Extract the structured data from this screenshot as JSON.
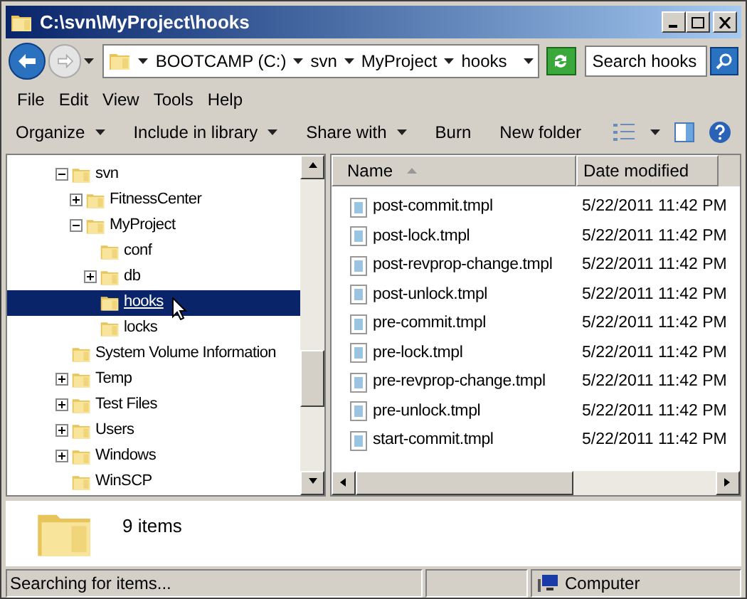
{
  "window": {
    "title": "C:\\svn\\MyProject\\hooks"
  },
  "address": {
    "crumbs": [
      "BOOTCAMP (C:)",
      "svn",
      "MyProject",
      "hooks"
    ]
  },
  "search": {
    "placeholder": "Search hooks"
  },
  "menu": [
    "File",
    "Edit",
    "View",
    "Tools",
    "Help"
  ],
  "toolbar": [
    {
      "label": "Organize",
      "dropdown": true
    },
    {
      "label": "Include in library",
      "dropdown": true
    },
    {
      "label": "Share with",
      "dropdown": true
    },
    {
      "label": "Burn",
      "dropdown": false
    },
    {
      "label": "New folder",
      "dropdown": false
    }
  ],
  "tree": [
    {
      "label": "svn",
      "expandable": true,
      "expanded": true,
      "selected": false,
      "children": [
        {
          "label": "FitnessCenter",
          "expandable": true,
          "expanded": false,
          "selected": false
        },
        {
          "label": "MyProject",
          "expandable": true,
          "expanded": true,
          "selected": false,
          "children": [
            {
              "label": "conf",
              "expandable": false,
              "selected": false
            },
            {
              "label": "db",
              "expandable": true,
              "expanded": false,
              "selected": false
            },
            {
              "label": "hooks",
              "expandable": false,
              "selected": true
            },
            {
              "label": "locks",
              "expandable": false,
              "selected": false
            }
          ]
        }
      ]
    },
    {
      "label": "System Volume Information",
      "expandable": false,
      "selected": false
    },
    {
      "label": "Temp",
      "expandable": true,
      "expanded": false,
      "selected": false
    },
    {
      "label": "Test Files",
      "expandable": true,
      "expanded": false,
      "selected": false
    },
    {
      "label": "Users",
      "expandable": true,
      "expanded": false,
      "selected": false
    },
    {
      "label": "Windows",
      "expandable": true,
      "expanded": false,
      "selected": false
    },
    {
      "label": "WinSCP",
      "expandable": false,
      "selected": false
    }
  ],
  "table": {
    "columns": [
      "Name",
      "Date modified"
    ],
    "rows": [
      {
        "name": "post-commit.tmpl",
        "date": "5/22/2011 11:42 PM"
      },
      {
        "name": "post-lock.tmpl",
        "date": "5/22/2011 11:42 PM"
      },
      {
        "name": "post-revprop-change.tmpl",
        "date": "5/22/2011 11:42 PM"
      },
      {
        "name": "post-unlock.tmpl",
        "date": "5/22/2011 11:42 PM"
      },
      {
        "name": "pre-commit.tmpl",
        "date": "5/22/2011 11:42 PM"
      },
      {
        "name": "pre-lock.tmpl",
        "date": "5/22/2011 11:42 PM"
      },
      {
        "name": "pre-revprop-change.tmpl",
        "date": "5/22/2011 11:42 PM"
      },
      {
        "name": "pre-unlock.tmpl",
        "date": "5/22/2011 11:42 PM"
      },
      {
        "name": "start-commit.tmpl",
        "date": "5/22/2011 11:42 PM"
      }
    ]
  },
  "details": {
    "count": "9 items"
  },
  "status_bar": {
    "message": "Searching for items...",
    "location": "Computer"
  }
}
